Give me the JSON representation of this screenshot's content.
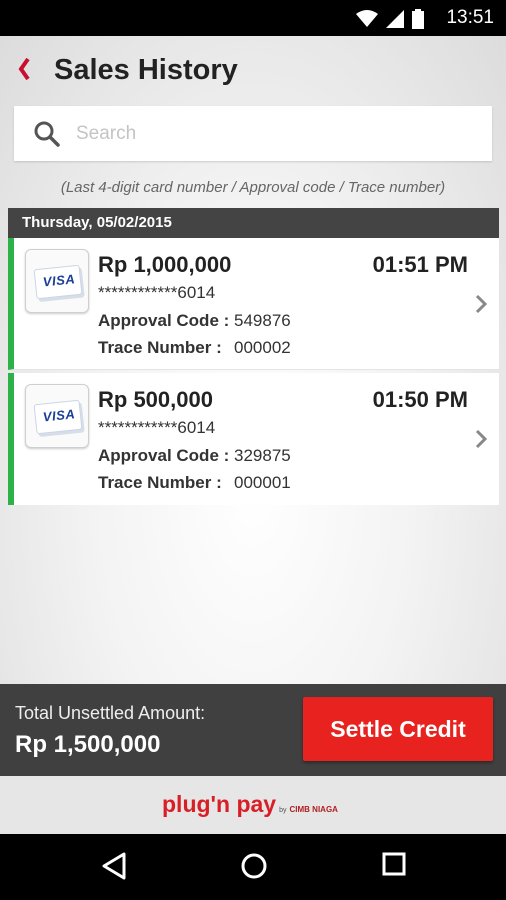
{
  "status_bar": {
    "time": "13:51"
  },
  "header": {
    "title": "Sales History"
  },
  "search": {
    "placeholder": "Search",
    "hint": "(Last 4-digit card number / Approval code / Trace number)"
  },
  "date_group": {
    "label": "Thursday, 05/02/2015"
  },
  "transactions": [
    {
      "card_brand": "VISA",
      "amount": "Rp 1,000,000",
      "time": "01:51 PM",
      "card_number": "************6014",
      "approval_label": "Approval Code :",
      "approval_code": "549876",
      "trace_label": "Trace Number  :",
      "trace_number": "000002"
    },
    {
      "card_brand": "VISA",
      "amount": "Rp 500,000",
      "time": "01:50 PM",
      "card_number": "************6014",
      "approval_label": "Approval Code :",
      "approval_code": "329875",
      "trace_label": "Trace Number  :",
      "trace_number": "000001"
    }
  ],
  "summary": {
    "total_label": "Total Unsettled Amount:",
    "total_value": "Rp 1,500,000",
    "settle_label": "Settle Credit"
  },
  "footer": {
    "brand": "plug'n pay",
    "by": "by",
    "partner": "CIMB NIAGA"
  },
  "colors": {
    "accent": "#e8231f",
    "status_green": "#2db24a",
    "back_red": "#c8102e"
  }
}
